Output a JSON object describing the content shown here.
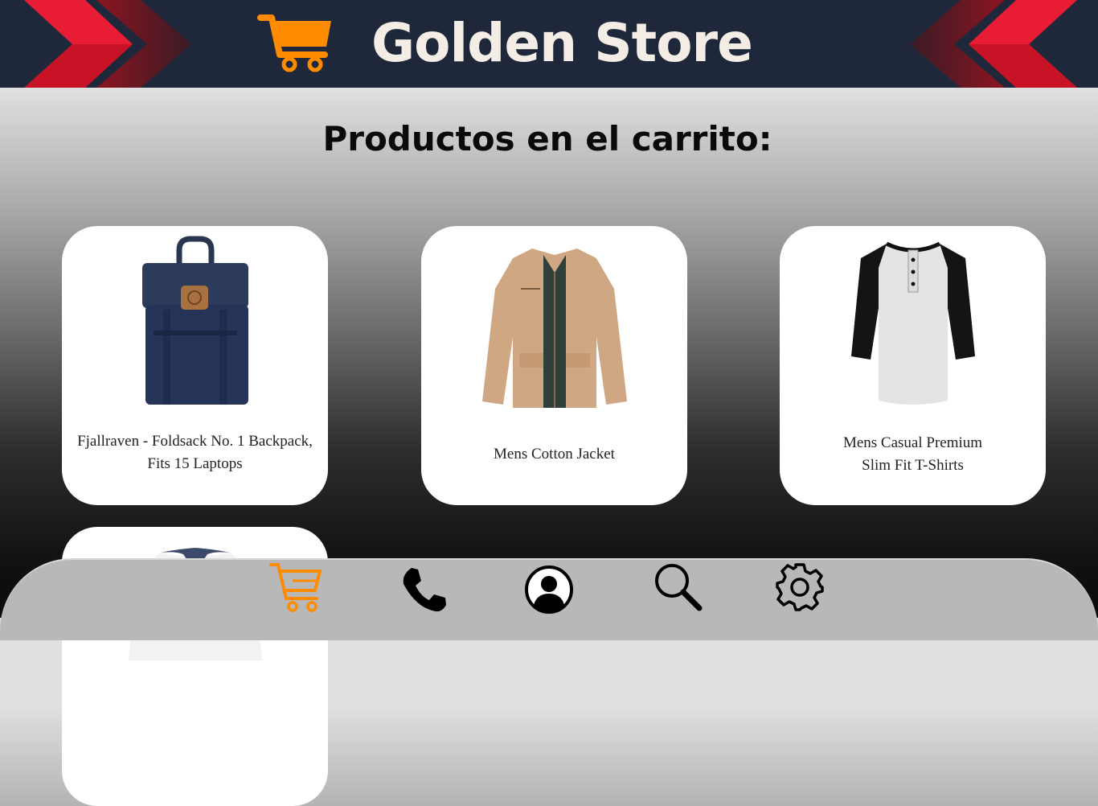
{
  "header": {
    "store_name": "Golden Store",
    "cart_logo_icon": "shopping-cart-icon",
    "colors": {
      "background": "#1f283a",
      "accent": "#ff8c00",
      "chevron": "#e8202f"
    }
  },
  "main": {
    "title": "Productos en el carrito:",
    "products": [
      {
        "name_line1": "Fjallraven - Foldsack No. 1 Backpack,",
        "name_line2": "Fits 15 Laptops",
        "image": "navy-backpack"
      },
      {
        "name_line1": "Mens Cotton Jacket",
        "name_line2": "",
        "image": "beige-jacket"
      },
      {
        "name_line1": "Mens Casual Premium",
        "name_line2": "Slim Fit T-Shirts",
        "image": "raglan-tshirt"
      },
      {
        "name_line1": "",
        "name_line2": "",
        "image": "white-long-sleeve-shirt"
      }
    ]
  },
  "nav": {
    "items": [
      {
        "icon": "shopping-cart-icon",
        "active": true
      },
      {
        "icon": "phone-icon",
        "active": false
      },
      {
        "icon": "user-profile-icon",
        "active": false
      },
      {
        "icon": "search-icon",
        "active": false
      },
      {
        "icon": "settings-gear-icon",
        "active": false
      }
    ]
  }
}
